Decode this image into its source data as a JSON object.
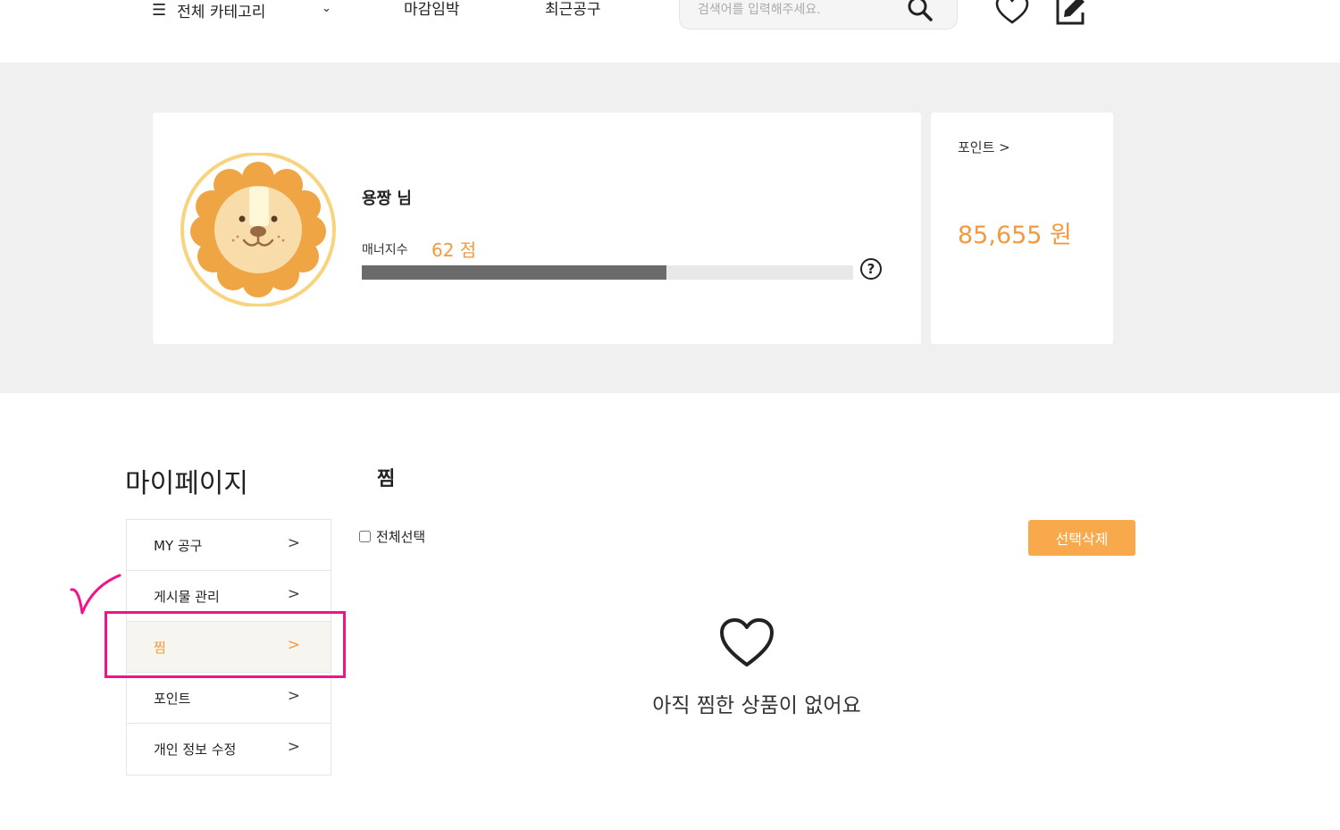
{
  "header": {
    "category_label": "전체 카테고리",
    "menu_icon": "☰",
    "chevron": "⌄",
    "nav_links": [
      "마감임박",
      "최근공구"
    ],
    "search_placeholder": "검색어를 입력해주세요."
  },
  "profile": {
    "name": "용짱 님",
    "manner_label": "매너지수",
    "manner_score": "62 점",
    "manner_fraction": 0.62,
    "help_symbol": "?"
  },
  "points_card": {
    "link_label": "포인트 >",
    "value": "85,655 원"
  },
  "sidebar": {
    "title": "마이페이지",
    "items": [
      {
        "label": "MY 공구",
        "active": false
      },
      {
        "label": "게시물 관리",
        "active": false
      },
      {
        "label": "찜",
        "active": true
      },
      {
        "label": "포인트",
        "active": false
      },
      {
        "label": "개인 정보 수정",
        "active": false
      }
    ]
  },
  "main": {
    "section_title": "찜",
    "select_all_label": "전체선택",
    "delete_button": "선택삭제",
    "empty_message": "아직 찜한 상품이 없어요"
  },
  "colors": {
    "accent": "#f49a3c",
    "button": "#f7a94b",
    "annotation": "#f0148c",
    "band": "#f0f0f0"
  }
}
